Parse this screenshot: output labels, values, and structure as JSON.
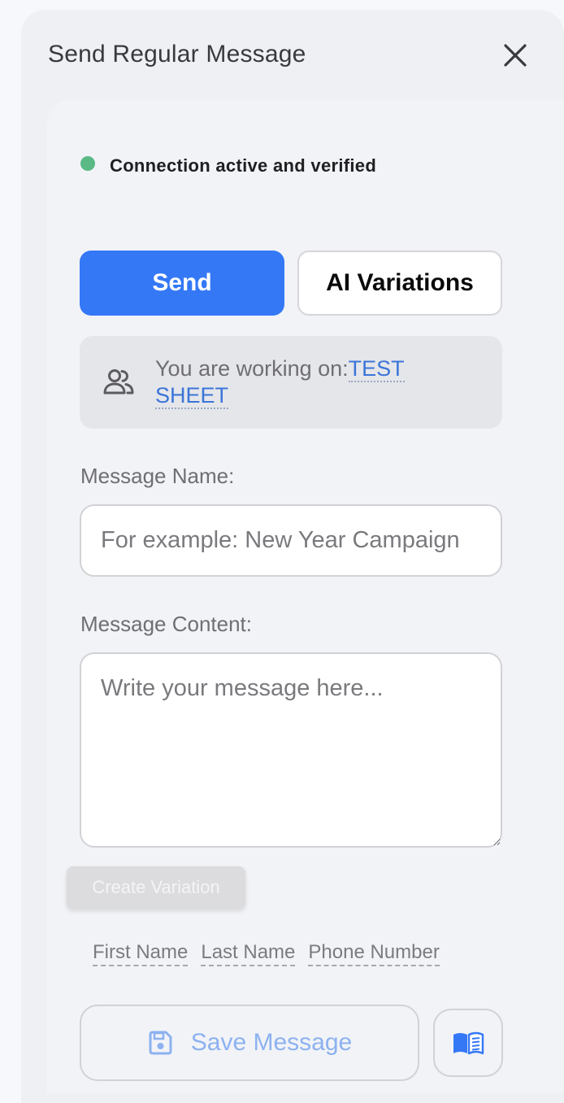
{
  "header": {
    "title": "Send Regular Message"
  },
  "status": {
    "text": "Connection active and verified",
    "color": "#5ab985"
  },
  "mode_buttons": {
    "send_label": "Send",
    "ai_label": "AI Variations"
  },
  "working_on": {
    "prefix": "You are working on:",
    "sheet_name": "TEST SHEET"
  },
  "message_name": {
    "label": "Message Name:",
    "placeholder": "For example: New Year Campaign",
    "value": ""
  },
  "message_content": {
    "label": "Message Content:",
    "placeholder": "Write your message here...",
    "value": ""
  },
  "create_variation": {
    "label": "Create Variation"
  },
  "variables": [
    "First Name",
    "Last Name",
    "Phone Number"
  ],
  "footer": {
    "save_label": "Save Message"
  },
  "colors": {
    "accent": "#3478f6",
    "link": "#3b75d9",
    "save_text": "#8cb2f0"
  },
  "icons": {
    "close": "close-icon",
    "people": "people-icon",
    "save": "floppy-disk-icon",
    "book": "book-icon"
  }
}
